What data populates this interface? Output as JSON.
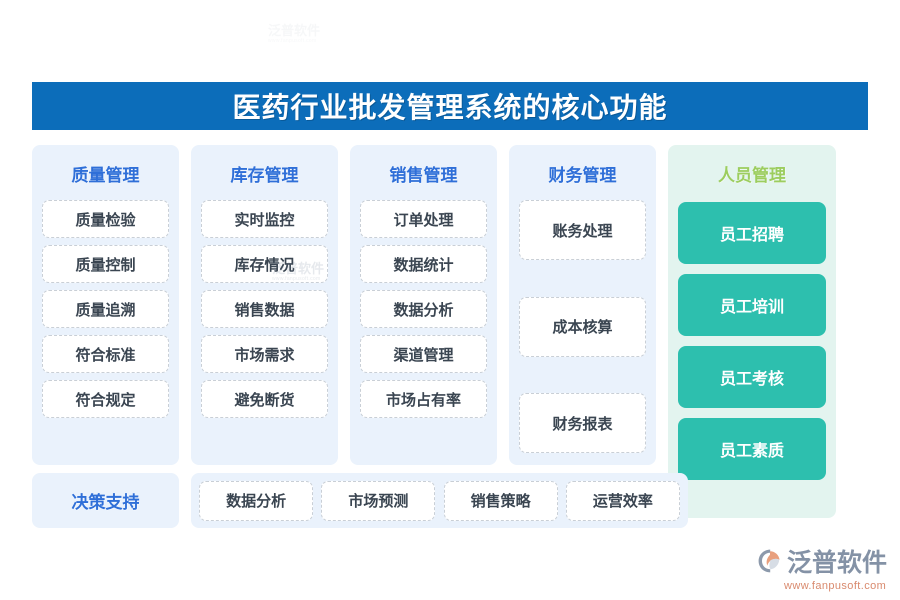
{
  "banner": {
    "title": "医药行业批发管理系统的核心功能",
    "background_color": "#0c6dba",
    "text_color": "#ffffff"
  },
  "theme": {
    "panel_blue_bg": "#eaf2fc",
    "panel_green_bg": "#e3f4ef",
    "title_blue": "#2f6fd8",
    "title_green": "#9ccd5f",
    "chip_bg": "#ffffff",
    "chip_border": "#c9cfd6",
    "chip_text": "#3a4551",
    "teal_button_bg": "#2dbfae",
    "teal_button_text": "#ffffff"
  },
  "columns": [
    {
      "title": "质量管理",
      "style": "blue",
      "items": [
        {
          "label": "质量检验"
        },
        {
          "label": "质量控制"
        },
        {
          "label": "质量追溯"
        },
        {
          "label": "符合标准"
        },
        {
          "label": "符合规定"
        }
      ]
    },
    {
      "title": "库存管理",
      "style": "blue",
      "items": [
        {
          "label": "实时监控"
        },
        {
          "label": "库存情况"
        },
        {
          "label": "销售数据"
        },
        {
          "label": "市场需求"
        },
        {
          "label": "避免断货"
        }
      ]
    },
    {
      "title": "销售管理",
      "style": "blue",
      "items": [
        {
          "label": "订单处理"
        },
        {
          "label": "数据统计"
        },
        {
          "label": "数据分析"
        },
        {
          "label": "渠道管理"
        },
        {
          "label": "市场占有率"
        }
      ]
    },
    {
      "title": "财务管理",
      "style": "blue-sparse",
      "items": [
        {
          "label": "账务处理"
        },
        {
          "label": "成本核算"
        },
        {
          "label": "财务报表"
        }
      ]
    },
    {
      "title": "人员管理",
      "style": "green",
      "items": [
        {
          "label": "员工招聘"
        },
        {
          "label": "员工培训"
        },
        {
          "label": "员工考核"
        },
        {
          "label": "员工素质"
        }
      ]
    }
  ],
  "bottom_row": {
    "title": "决策支持",
    "items": [
      {
        "label": "数据分析"
      },
      {
        "label": "市场预测"
      },
      {
        "label": "销售策略"
      },
      {
        "label": "运营效率"
      }
    ]
  },
  "watermark": {
    "main": "泛普软件",
    "sub": "www.fanpusoft.com"
  },
  "logo": {
    "name": "泛普软件",
    "url": "www.fanpusoft.com",
    "mark_colors": {
      "swoosh": "#8c99ab",
      "accent": "#e8a07e"
    }
  }
}
